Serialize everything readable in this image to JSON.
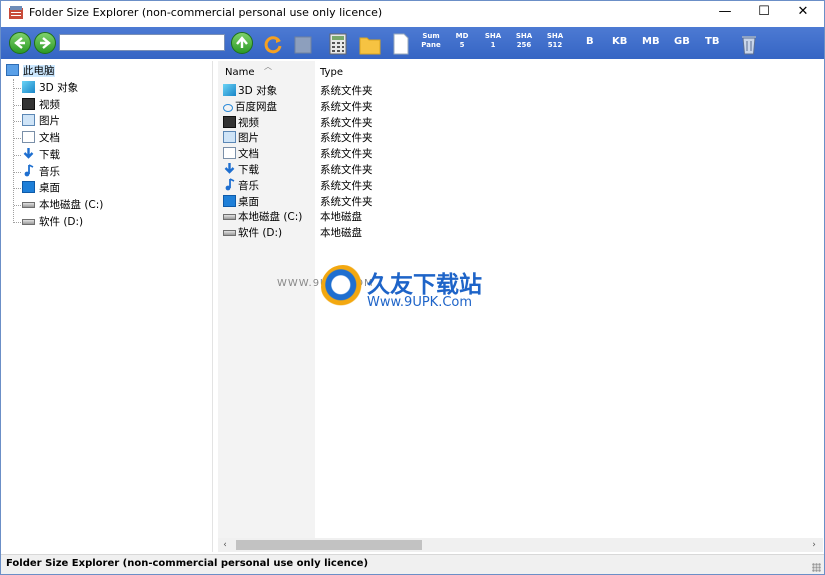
{
  "window": {
    "title": "Folder Size Explorer (non-commercial personal use only licence)",
    "minimize": "—",
    "maximize": "☐",
    "close": "✕"
  },
  "toolbar": {
    "path_value": "",
    "sum_pane": [
      "Sum",
      "Pane"
    ],
    "md5": [
      "MD",
      "5"
    ],
    "sha1": [
      "SHA",
      "1"
    ],
    "sha256": [
      "SHA",
      "256"
    ],
    "sha512": [
      "SHA",
      "512"
    ],
    "units": [
      "B",
      "KB",
      "MB",
      "GB",
      "TB"
    ],
    "accent": "#3f6fcc"
  },
  "tree": {
    "root": "此电脑",
    "items": [
      {
        "label": "3D 对象",
        "icon": "cube-icon"
      },
      {
        "label": "视频",
        "icon": "video-icon"
      },
      {
        "label": "图片",
        "icon": "picture-icon"
      },
      {
        "label": "文档",
        "icon": "document-icon"
      },
      {
        "label": "下载",
        "icon": "download-icon"
      },
      {
        "label": "音乐",
        "icon": "music-icon"
      },
      {
        "label": "桌面",
        "icon": "desktop-icon"
      },
      {
        "label": "本地磁盘 (C:)",
        "icon": "drive-icon"
      },
      {
        "label": "软件 (D:)",
        "icon": "drive-icon"
      }
    ]
  },
  "list": {
    "columns": [
      "Name",
      "Type"
    ],
    "rows": [
      {
        "name": "3D 对象",
        "type": "系统文件夹",
        "icon": "cube-icon"
      },
      {
        "name": "百度网盘",
        "type": "系统文件夹",
        "icon": "cloud-icon"
      },
      {
        "name": "视频",
        "type": "系统文件夹",
        "icon": "video-icon"
      },
      {
        "name": "图片",
        "type": "系统文件夹",
        "icon": "picture-icon"
      },
      {
        "name": "文档",
        "type": "系统文件夹",
        "icon": "document-icon"
      },
      {
        "name": "下载",
        "type": "系统文件夹",
        "icon": "download-icon"
      },
      {
        "name": "音乐",
        "type": "系统文件夹",
        "icon": "music-icon"
      },
      {
        "name": "桌面",
        "type": "系统文件夹",
        "icon": "desktop-icon"
      },
      {
        "name": "本地磁盘 (C:)",
        "type": "本地磁盘",
        "icon": "drive-icon"
      },
      {
        "name": "软件 (D:)",
        "type": "本地磁盘",
        "icon": "drive-icon"
      }
    ]
  },
  "watermark": {
    "small": "WWW.9UPK.COM",
    "cn": "久友下载站",
    "en": "Www.9UPK.Com"
  },
  "status": {
    "text": "Folder Size Explorer (non-commercial personal use only licence)"
  }
}
